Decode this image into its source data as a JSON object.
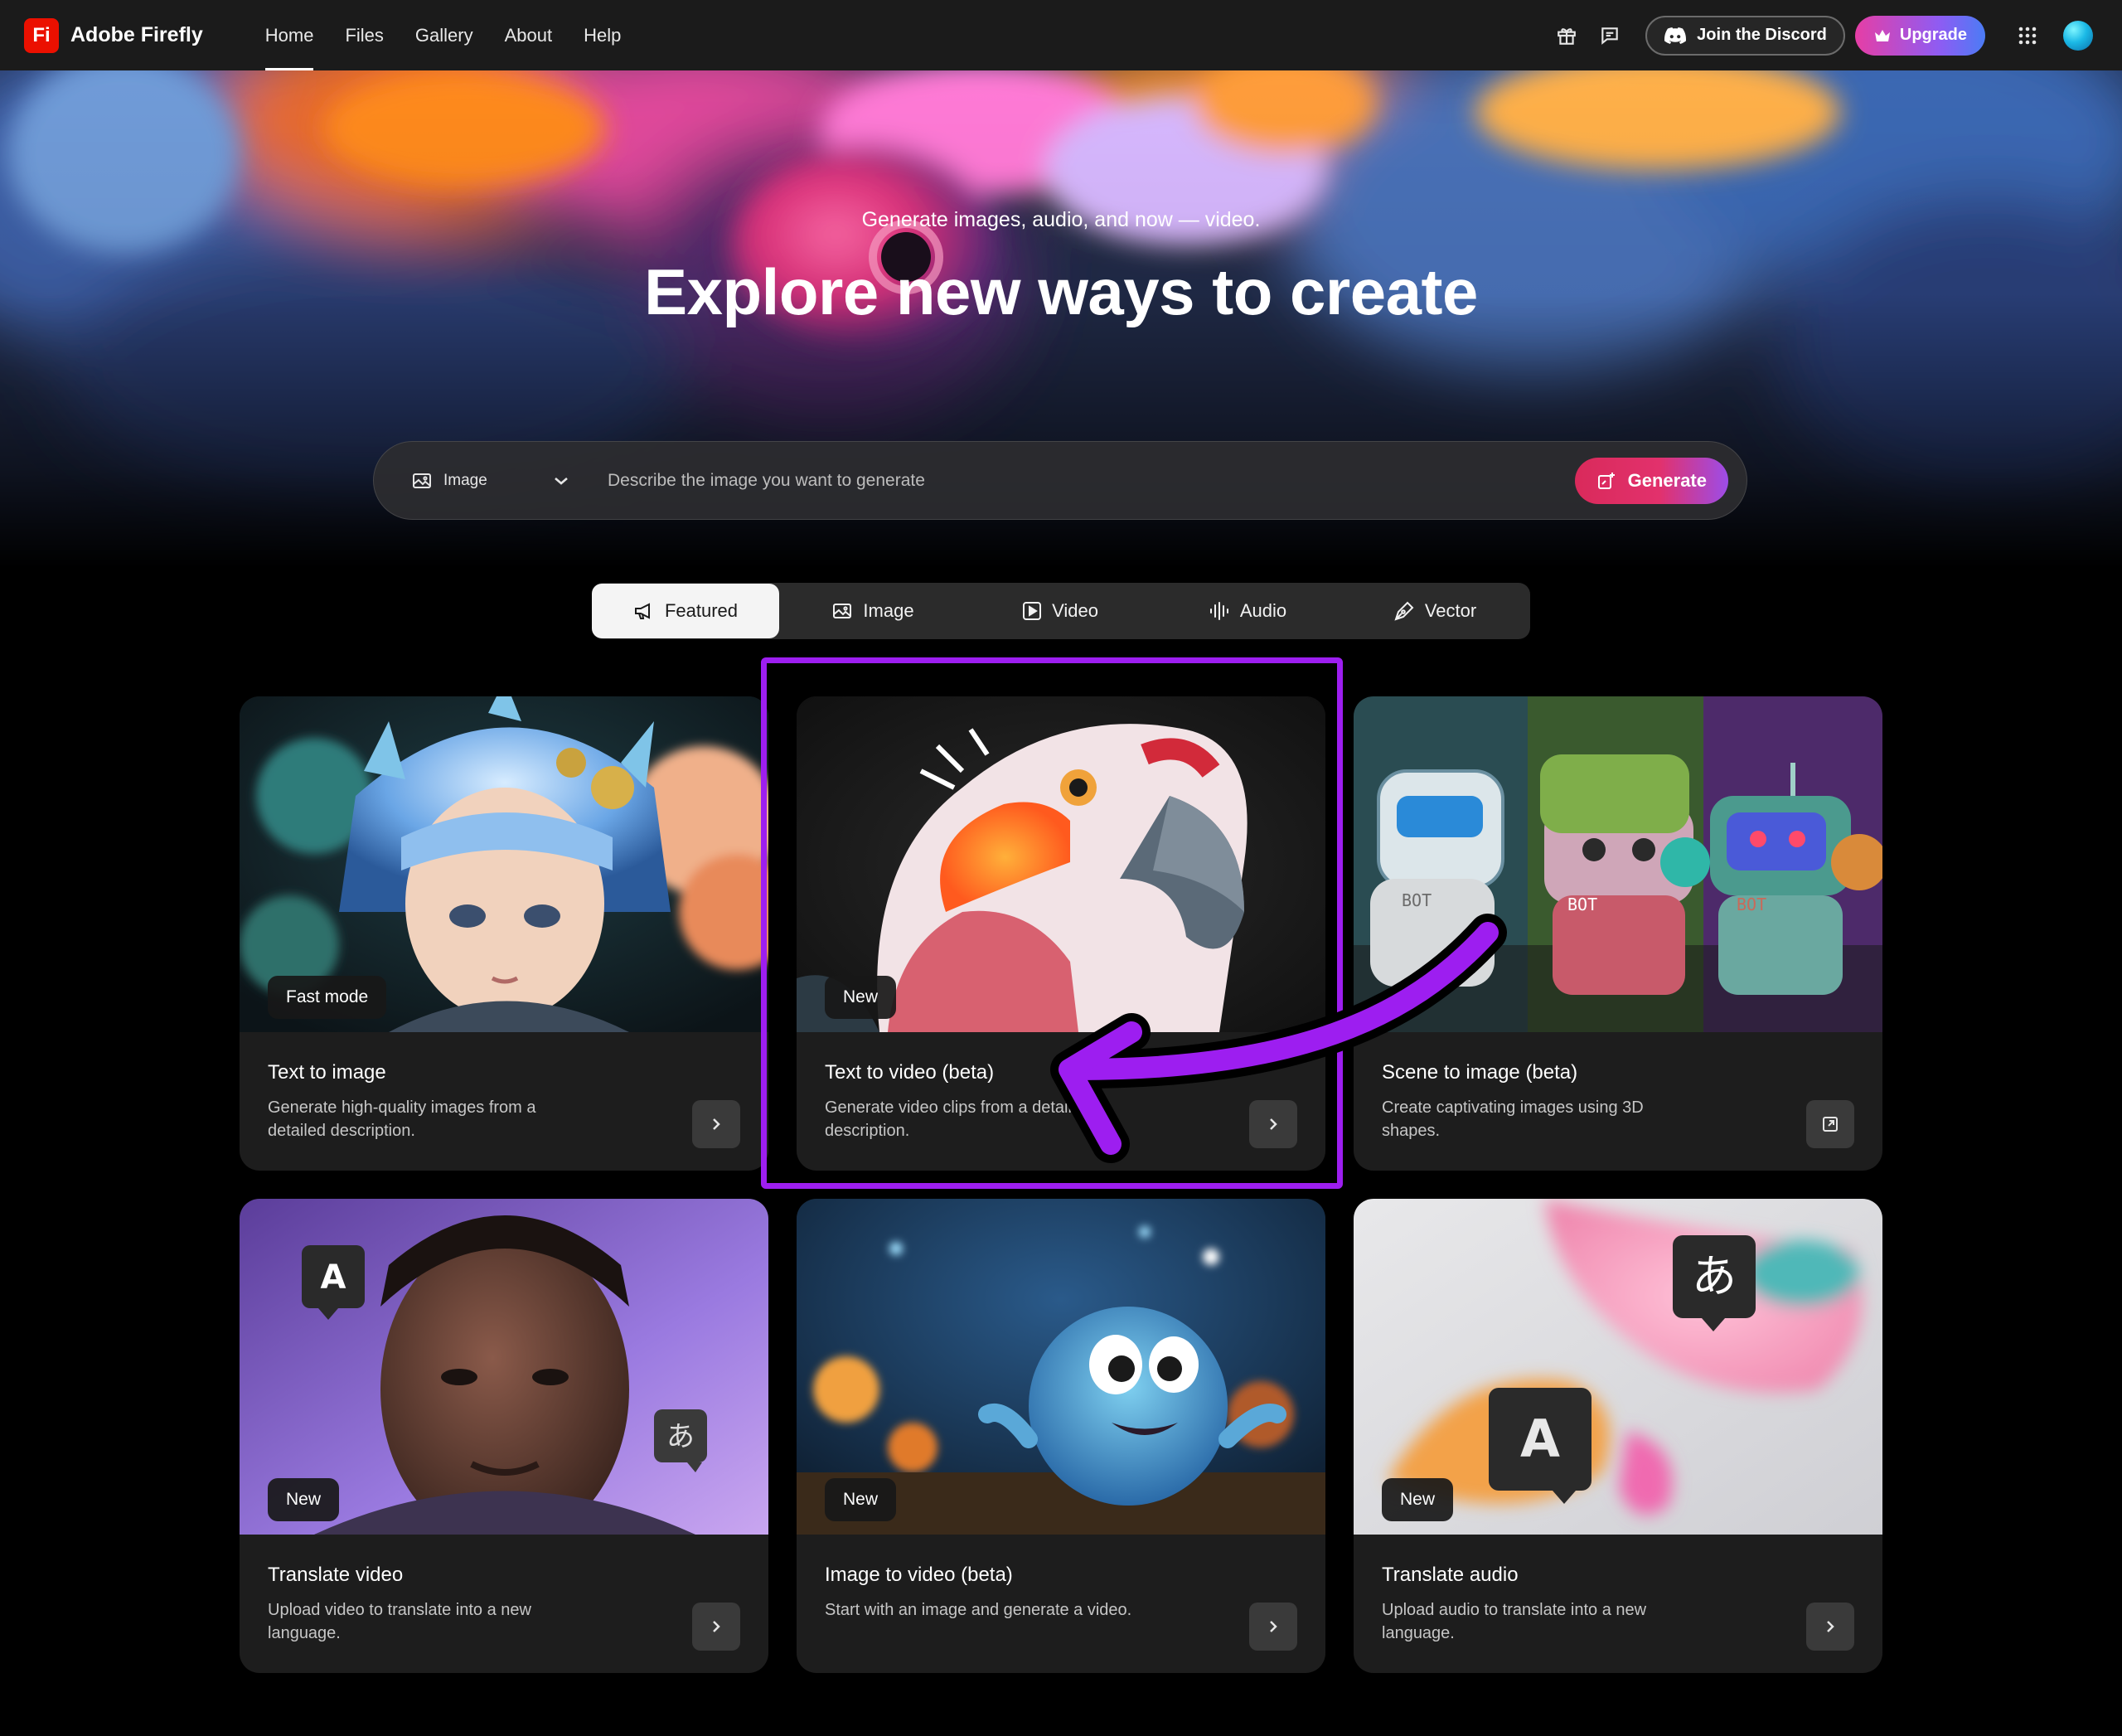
{
  "app": {
    "brand_logo": "Fi",
    "brand_name": "Adobe Firefly"
  },
  "nav": {
    "items": [
      "Home",
      "Files",
      "Gallery",
      "About",
      "Help"
    ],
    "active": "Home"
  },
  "top_right": {
    "discord_label": "Join the Discord",
    "upgrade_label": "Upgrade",
    "icons": [
      "gift-icon",
      "feedback-icon",
      "discord-icon",
      "crown-icon",
      "apps-grid-icon",
      "avatar"
    ]
  },
  "hero": {
    "subtitle": "Generate images, audio, and now — video.",
    "title": "Explore new ways to create",
    "prompt": {
      "type_label": "Image",
      "placeholder": "Describe the image you want to generate",
      "generate_label": "Generate"
    }
  },
  "tabs": [
    {
      "label": "Featured",
      "icon": "megaphone-icon",
      "active": true
    },
    {
      "label": "Image",
      "icon": "image-icon",
      "active": false
    },
    {
      "label": "Video",
      "icon": "video-icon",
      "active": false
    },
    {
      "label": "Audio",
      "icon": "waveform-icon",
      "active": false
    },
    {
      "label": "Vector",
      "icon": "pen-icon",
      "active": false
    }
  ],
  "cards": [
    {
      "badge": "Fast mode",
      "title": "Text to image",
      "desc": "Generate high-quality images from a detailed description.",
      "action_icon": "chevron-right-icon"
    },
    {
      "badge": "New",
      "title": "Text to video (beta)",
      "desc": "Generate video clips from a detailed description.",
      "action_icon": "chevron-right-icon"
    },
    {
      "badge": "",
      "title": "Scene to image (beta)",
      "desc": "Create captivating images using 3D shapes.",
      "action_icon": "open-external-icon"
    },
    {
      "badge": "New",
      "title": "Translate video",
      "desc": "Upload video to translate into a new language.",
      "action_icon": "chevron-right-icon"
    },
    {
      "badge": "New",
      "title": "Image to video (beta)",
      "desc": "Start with an image and generate a video.",
      "action_icon": "chevron-right-icon"
    },
    {
      "badge": "New",
      "title": "Translate audio",
      "desc": "Upload audio to translate into a new language.",
      "action_icon": "chevron-right-icon"
    }
  ],
  "art_text": {
    "bot": "BOT",
    "latin_a": "A",
    "kana_a": "あ"
  },
  "colors": {
    "brand_red": "#eb1000",
    "highlight_purple": "#9d1ef0",
    "generate_gradient_start": "#d92a5b",
    "upgrade_gradient_end": "#4b7cf5"
  }
}
